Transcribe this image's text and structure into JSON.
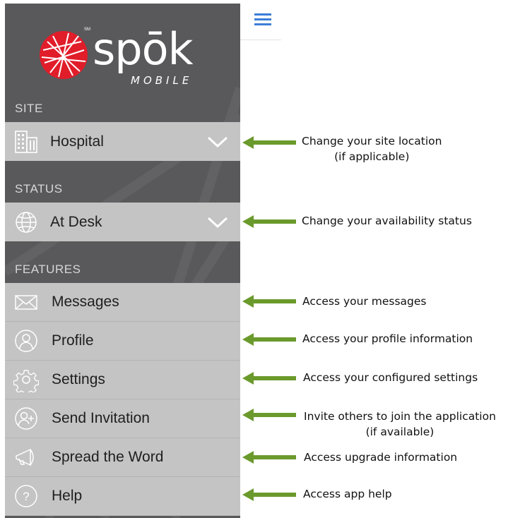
{
  "app": {
    "logo_text": "spōk",
    "logo_subtext": "MOBILE",
    "logo_mark": "SM",
    "accent_red": "#e11d2a",
    "drawer_bg": "#59595b",
    "row_bg": "#c4c4c4",
    "menu_icon": "hamburger-menu-icon",
    "menu_icon_color": "#3b7dd8"
  },
  "drawer": {
    "site_header": "SITE",
    "site": {
      "label": "Hospital",
      "icon": "building-icon"
    },
    "status_header": "STATUS",
    "status": {
      "label": "At Desk",
      "icon": "globe-icon"
    },
    "features_header": "FEATURES",
    "features": [
      {
        "label": "Messages",
        "icon": "envelope-icon"
      },
      {
        "label": "Profile",
        "icon": "user-icon"
      },
      {
        "label": "Settings",
        "icon": "gear-icon"
      },
      {
        "label": "Send Invitation",
        "icon": "user-add-icon"
      },
      {
        "label": "Spread the Word",
        "icon": "megaphone-icon"
      },
      {
        "label": "Help",
        "icon": "question-icon"
      }
    ]
  },
  "annotations": {
    "arrow_color": "#6b9a2c",
    "site": [
      "Change your site location",
      "(if applicable)"
    ],
    "status": [
      "Change your availability status"
    ],
    "messages": [
      "Access your messages"
    ],
    "profile": [
      "Access your profile information"
    ],
    "settings": [
      "Access your configured settings"
    ],
    "invitation": [
      "Invite others to join the application",
      "(if available)"
    ],
    "spread": [
      "Access upgrade information"
    ],
    "help": [
      "Access app help"
    ]
  }
}
